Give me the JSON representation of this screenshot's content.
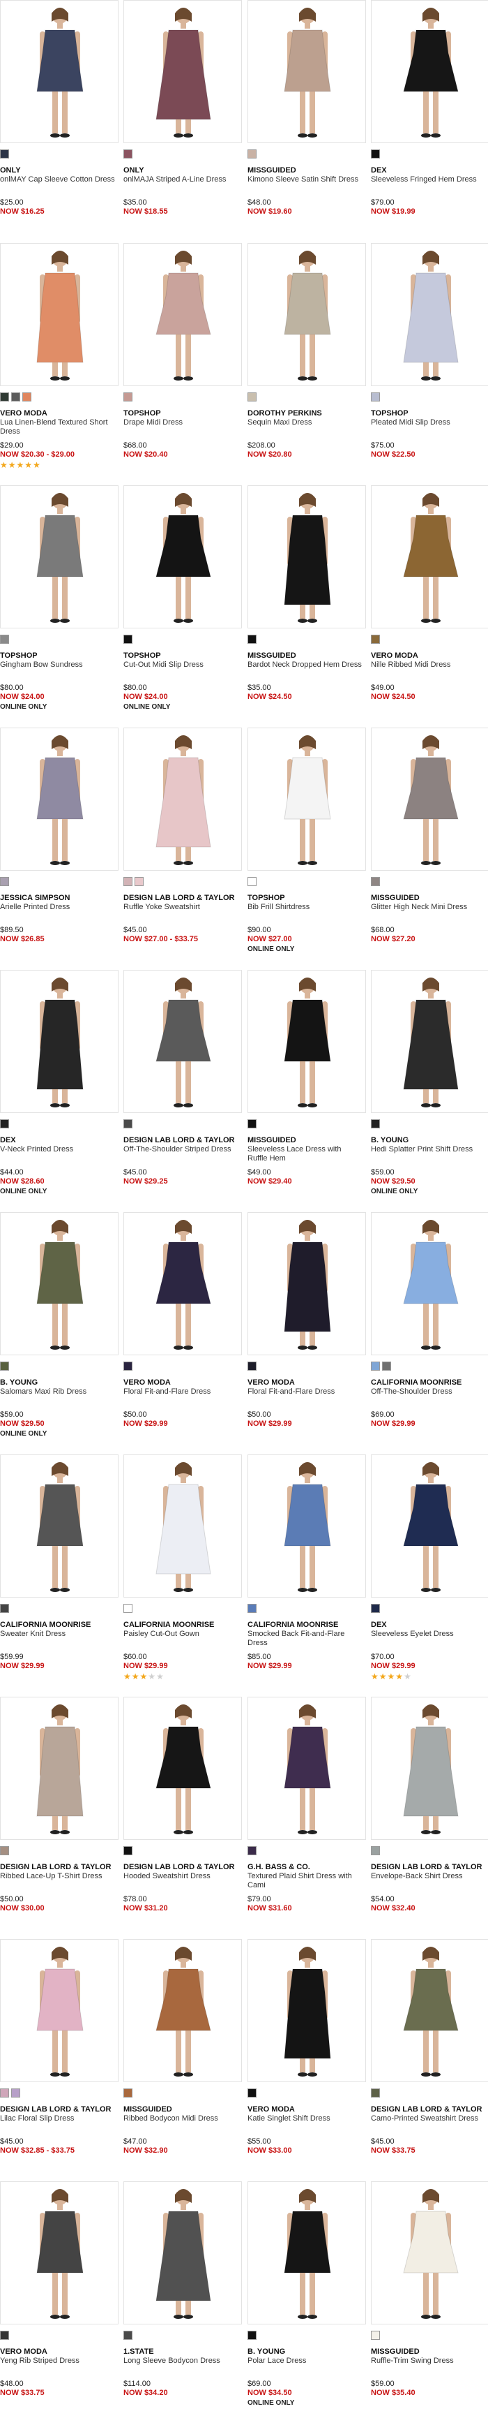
{
  "products": [
    {
      "brand": "ONLY",
      "name": "onlMAY Cap Sleeve Cotton Dress",
      "price": "$25.00",
      "now": "NOW $16.25",
      "swatches": [
        "#2c3447"
      ],
      "color": "#3b4460"
    },
    {
      "brand": "ONLY",
      "name": "onlMAJA Striped A-Line Dress",
      "price": "$35.00",
      "now": "NOW $18.55",
      "swatches": [
        "#8a5360"
      ],
      "color": "#7b4a55"
    },
    {
      "brand": "MISSGUIDED",
      "name": "Kimono Sleeve Satin Shift Dress",
      "price": "$48.00",
      "now": "NOW $19.60",
      "swatches": [
        "#c9b2a5"
      ],
      "color": "#bca08f"
    },
    {
      "brand": "DEX",
      "name": "Sleeveless Fringed Hem Dress",
      "price": "$79.00",
      "now": "NOW $19.99",
      "swatches": [
        "#111111"
      ],
      "color": "#161616"
    },
    {
      "brand": "VERO MODA",
      "name": "Lua Linen-Blend Textured Short Dress",
      "price": "$29.00",
      "now": "NOW $20.30 - $29.00",
      "swatches": [
        "#2f3a33",
        "#5c5c5c",
        "#e0865f"
      ],
      "color": "#e08d67",
      "stars": 5
    },
    {
      "brand": "TOPSHOP",
      "name": "Drape Midi Dress",
      "price": "$68.00",
      "now": "NOW $20.40",
      "swatches": [
        "#c59a93"
      ],
      "color": "#c9a39c"
    },
    {
      "brand": "DOROTHY PERKINS",
      "name": "Sequin Maxi Dress",
      "price": "$208.00",
      "now": "NOW $20.80",
      "swatches": [
        "#c9bfae"
      ],
      "color": "#bdb3a1"
    },
    {
      "brand": "TOPSHOP",
      "name": "Pleated Midi Slip Dress",
      "price": "$75.00",
      "now": "NOW $22.50",
      "swatches": [
        "#b8bdd0"
      ],
      "color": "#c5c9dc"
    },
    {
      "brand": "TOPSHOP",
      "name": "Gingham Bow Sundress",
      "price": "$80.00",
      "now": "NOW $24.00",
      "online": "ONLINE ONLY",
      "swatches": [
        "#8a8a8a"
      ],
      "color": "#7a7a7a"
    },
    {
      "brand": "TOPSHOP",
      "name": "Cut-Out Midi Slip Dress",
      "price": "$80.00",
      "now": "NOW $24.00",
      "online": "ONLINE ONLY",
      "swatches": [
        "#111111"
      ],
      "color": "#141414"
    },
    {
      "brand": "MISSGUIDED",
      "name": "Bardot Neck Dropped Hem Dress",
      "price": "$35.00",
      "now": "NOW $24.50",
      "swatches": [
        "#111111"
      ],
      "color": "#151515"
    },
    {
      "brand": "VERO MODA",
      "name": "Nille Ribbed Midi Dress",
      "price": "$49.00",
      "now": "NOW $24.50",
      "swatches": [
        "#8a6a3a"
      ],
      "color": "#8c6633"
    },
    {
      "brand": "JESSICA SIMPSON",
      "name": "Arielle Printed Dress",
      "price": "$89.50",
      "now": "NOW $26.85",
      "swatches": [
        "#a9a0b0"
      ],
      "color": "#8f8aa2"
    },
    {
      "brand": "DESIGN LAB LORD & TAYLOR",
      "name": "Ruffle Yoke Sweatshirt",
      "price": "$45.00",
      "now": "NOW $27.00 - $33.75",
      "swatches": [
        "#d2b3b6",
        "#e9c9cc"
      ],
      "color": "#e7c6c8"
    },
    {
      "brand": "TOPSHOP",
      "name": "Bib Frill Shirtdress",
      "price": "$90.00",
      "now": "NOW $27.00",
      "online": "ONLINE ONLY",
      "swatches": [
        "#ffffff"
      ],
      "color": "#f4f4f4"
    },
    {
      "brand": "MISSGUIDED",
      "name": "Glitter High Neck Mini Dress",
      "price": "$68.00",
      "now": "NOW $27.20",
      "swatches": [
        "#8f8684"
      ],
      "color": "#8c8281"
    },
    {
      "brand": "DEX",
      "name": "V-Neck Printed Dress",
      "price": "$44.00",
      "now": "NOW $28.60",
      "online": "ONLINE ONLY",
      "swatches": [
        "#222222"
      ],
      "color": "#262626"
    },
    {
      "brand": "DESIGN LAB LORD & TAYLOR",
      "name": "Off-The-Shoulder Striped Dress",
      "price": "$45.00",
      "now": "NOW $29.25",
      "swatches": [
        "#4a4a4a"
      ],
      "color": "#5a5a5a"
    },
    {
      "brand": "MISSGUIDED",
      "name": "Sleeveless Lace Dress with Ruffle Hem",
      "price": "$49.00",
      "now": "NOW $29.40",
      "swatches": [
        "#111111"
      ],
      "color": "#141414"
    },
    {
      "brand": "B. YOUNG",
      "name": "Hedi Splatter Print Shift Dress",
      "price": "$59.00",
      "now": "NOW $29.50",
      "online": "ONLINE ONLY",
      "swatches": [
        "#222222"
      ],
      "color": "#2b2b2b"
    },
    {
      "brand": "B. YOUNG",
      "name": "Salomars Maxi Rib Dress",
      "price": "$59.00",
      "now": "NOW $29.50",
      "online": "ONLINE ONLY",
      "swatches": [
        "#59613f"
      ],
      "color": "#5f6446"
    },
    {
      "brand": "VERO MODA",
      "name": "Floral Fit-and-Flare Dress",
      "price": "$50.00",
      "now": "NOW $29.99",
      "swatches": [
        "#2a2440"
      ],
      "color": "#2c2642"
    },
    {
      "brand": "VERO MODA",
      "name": "Floral Fit-and-Flare Dress",
      "price": "$50.00",
      "now": "NOW $29.99",
      "swatches": [
        "#1d1d2a"
      ],
      "color": "#1f1c2b"
    },
    {
      "brand": "CALIFORNIA MOONRISE",
      "name": "Off-The-Shoulder Dress",
      "price": "$69.00",
      "now": "NOW $29.99",
      "swatches": [
        "#7fa6d6",
        "#707070"
      ],
      "color": "#88aee0"
    },
    {
      "brand": "CALIFORNIA MOONRISE",
      "name": "Sweater Knit Dress",
      "price": "$59.99",
      "now": "NOW $29.99",
      "swatches": [
        "#444444"
      ],
      "color": "#555555"
    },
    {
      "brand": "CALIFORNIA MOONRISE",
      "name": "Paisley Cut-Out Gown",
      "price": "$60.00",
      "now": "NOW $29.99",
      "swatches": [
        "#ffffff"
      ],
      "color": "#eceef4",
      "stars": 3
    },
    {
      "brand": "CALIFORNIA MOONRISE",
      "name": "Smocked Back Fit-and-Flare Dress",
      "price": "$85.00",
      "now": "NOW $29.99",
      "swatches": [
        "#5a7cb8"
      ],
      "color": "#5b7cb5"
    },
    {
      "brand": "DEX",
      "name": "Sleeveless Eyelet Dress",
      "price": "$70.00",
      "now": "NOW $29.99",
      "swatches": [
        "#1f2a4a"
      ],
      "color": "#1f2c52",
      "stars": 4
    },
    {
      "brand": "DESIGN LAB LORD & TAYLOR",
      "name": "Ribbed Lace-Up T-Shirt Dress",
      "price": "$50.00",
      "now": "NOW $30.00",
      "swatches": [
        "#a58f82"
      ],
      "color": "#b8a699"
    },
    {
      "brand": "DESIGN LAB LORD & TAYLOR",
      "name": "Hooded Sweatshirt Dress",
      "price": "$78.00",
      "now": "NOW $31.20",
      "swatches": [
        "#111111"
      ],
      "color": "#161616"
    },
    {
      "brand": "G.H. BASS & CO.",
      "name": "Textured Plaid Shirt Dress with Cami",
      "price": "$79.00",
      "now": "NOW $31.60",
      "swatches": [
        "#3b2b4a"
      ],
      "color": "#3f2d4f"
    },
    {
      "brand": "DESIGN LAB LORD & TAYLOR",
      "name": "Envelope-Back Shirt Dress",
      "price": "$54.00",
      "now": "NOW $32.40",
      "swatches": [
        "#9aa1a0"
      ],
      "color": "#a5aaaa"
    },
    {
      "brand": "DESIGN LAB LORD & TAYLOR",
      "name": "Lilac Floral Slip Dress",
      "price": "$45.00",
      "now": "NOW $32.85 - $33.75",
      "swatches": [
        "#cfa6b9",
        "#b7a0c8"
      ],
      "color": "#e2b3c5"
    },
    {
      "brand": "MISSGUIDED",
      "name": "Ribbed Bodycon Midi Dress",
      "price": "$47.00",
      "now": "NOW $32.90",
      "swatches": [
        "#a8683d"
      ],
      "color": "#a8683e"
    },
    {
      "brand": "VERO MODA",
      "name": "Katie Singlet Shift Dress",
      "price": "$55.00",
      "now": "NOW $33.00",
      "swatches": [
        "#111111"
      ],
      "color": "#141414"
    },
    {
      "brand": "DESIGN LAB LORD & TAYLOR",
      "name": "Camo-Printed Sweatshirt Dress",
      "price": "$45.00",
      "now": "NOW $33.75",
      "swatches": [
        "#5d6148"
      ],
      "color": "#6a6d4f"
    },
    {
      "brand": "VERO MODA",
      "name": "Yeng Rib Striped Dress",
      "price": "$48.00",
      "now": "NOW $33.75",
      "swatches": [
        "#333333"
      ],
      "color": "#444444"
    },
    {
      "brand": "1.STATE",
      "name": "Long Sleeve Bodycon Dress",
      "price": "$114.00",
      "now": "NOW $34.20",
      "swatches": [
        "#4a4a4a"
      ],
      "color": "#515151"
    },
    {
      "brand": "B. YOUNG",
      "name": "Polar Lace Dress",
      "price": "$69.00",
      "now": "NOW $34.50",
      "online": "ONLINE ONLY",
      "swatches": [
        "#111111"
      ],
      "color": "#151515"
    },
    {
      "brand": "MISSGUIDED",
      "name": "Ruffle-Trim Swing Dress",
      "price": "$59.00",
      "now": "NOW $35.40",
      "swatches": [
        "#f4f1ea"
      ],
      "color": "#f2eee4"
    }
  ]
}
